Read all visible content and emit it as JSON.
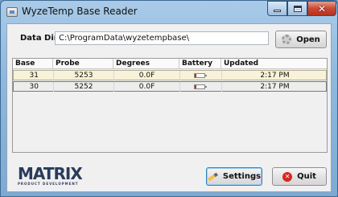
{
  "window": {
    "title": "WyzeTemp Base Reader",
    "close_glyph": "✕"
  },
  "dir": {
    "label": "Data Dir",
    "value": "C:\\ProgramData\\wyzetempbase\\"
  },
  "buttons": {
    "open_label": "Open",
    "settings_label": "Settings",
    "quit_label": "Quit"
  },
  "grid": {
    "columns": [
      "Base",
      "Probe",
      "Degrees",
      "Battery",
      "Updated"
    ],
    "rows": [
      {
        "base": "31",
        "probe": "5253",
        "degrees": "0.0F",
        "battery": "low",
        "updated": "2:17 PM"
      },
      {
        "base": "30",
        "probe": "5252",
        "degrees": "0.0F",
        "battery": "low",
        "updated": "2:17 PM"
      }
    ]
  },
  "logo": {
    "word": "MATRIX",
    "sub": "PRODUCT DEVELOPMENT"
  },
  "icons": {
    "open": "gear-icon",
    "settings": "pencil-icon",
    "quit": "close-circle-icon",
    "battery": "battery-low-icon"
  }
}
